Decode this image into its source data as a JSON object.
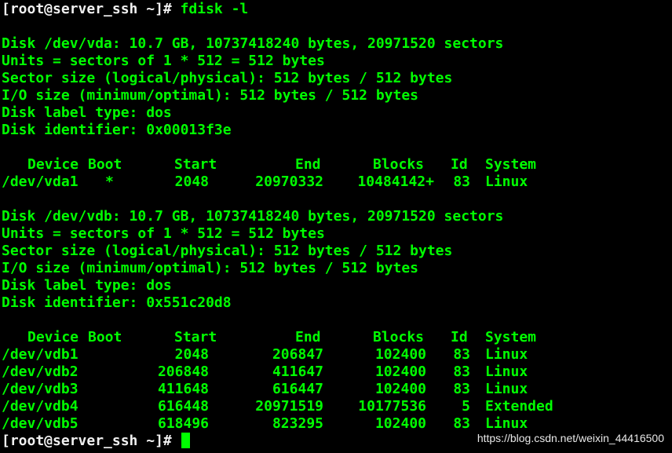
{
  "terminal": {
    "prompt": "[root@server_ssh ~]# ",
    "command": "fdisk -l",
    "disks": [
      {
        "header_lines": [
          "Disk /dev/vda: 10.7 GB, 10737418240 bytes, 20971520 sectors",
          "Units = sectors of 1 * 512 = 512 bytes",
          "Sector size (logical/physical): 512 bytes / 512 bytes",
          "I/O size (minimum/optimal): 512 bytes / 512 bytes",
          "Disk label type: dos",
          "Disk identifier: 0x00013f3e"
        ],
        "columns": [
          "Device",
          "Boot",
          "Start",
          "End",
          "Blocks",
          "Id",
          "System"
        ],
        "partitions": [
          {
            "device": "/dev/vda1",
            "boot": "*",
            "start": "2048",
            "end": "20970332",
            "blocks": "10484142+",
            "id": "83",
            "system": "Linux"
          }
        ]
      },
      {
        "header_lines": [
          "Disk /dev/vdb: 10.7 GB, 10737418240 bytes, 20971520 sectors",
          "Units = sectors of 1 * 512 = 512 bytes",
          "Sector size (logical/physical): 512 bytes / 512 bytes",
          "I/O size (minimum/optimal): 512 bytes / 512 bytes",
          "Disk label type: dos",
          "Disk identifier: 0x551c20d8"
        ],
        "columns": [
          "Device",
          "Boot",
          "Start",
          "End",
          "Blocks",
          "Id",
          "System"
        ],
        "partitions": [
          {
            "device": "/dev/vdb1",
            "boot": "",
            "start": "2048",
            "end": "206847",
            "blocks": "102400",
            "id": "83",
            "system": "Linux"
          },
          {
            "device": "/dev/vdb2",
            "boot": "",
            "start": "206848",
            "end": "411647",
            "blocks": "102400",
            "id": "83",
            "system": "Linux"
          },
          {
            "device": "/dev/vdb3",
            "boot": "",
            "start": "411648",
            "end": "616447",
            "blocks": "102400",
            "id": "83",
            "system": "Linux"
          },
          {
            "device": "/dev/vdb4",
            "boot": "",
            "start": "616448",
            "end": "20971519",
            "blocks": "10177536",
            "id": "5",
            "system": "Extended"
          },
          {
            "device": "/dev/vdb5",
            "boot": "",
            "start": "618496",
            "end": "823295",
            "blocks": "102400",
            "id": "83",
            "system": "Linux"
          }
        ]
      }
    ],
    "final_prompt": "[root@server_ssh ~]# "
  },
  "watermark": "https://blog.csdn.net/weixin_44416500",
  "colors": {
    "background": "#000000",
    "output_text": "#00ff00",
    "prompt_text": "#f0f0f0"
  }
}
